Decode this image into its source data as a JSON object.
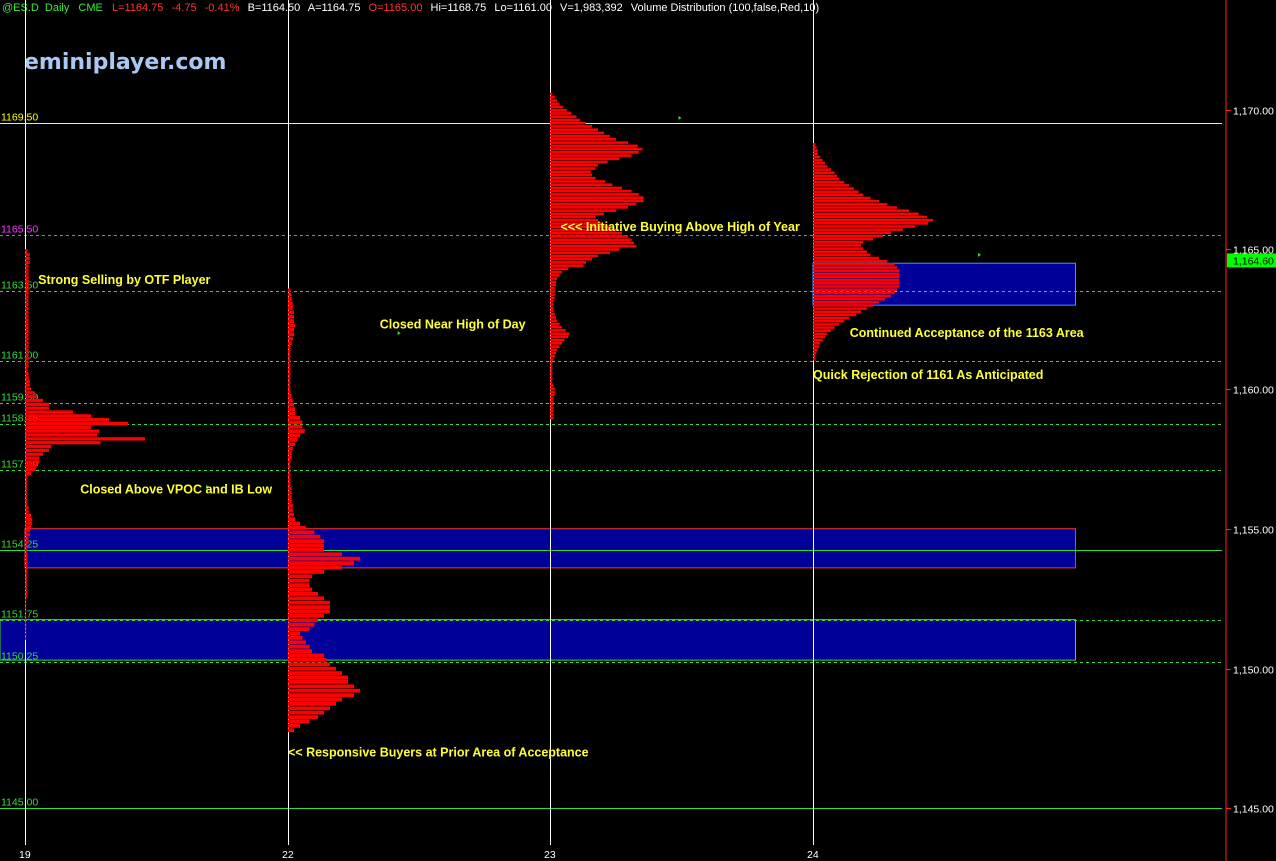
{
  "header": {
    "symbol": "@ES.D",
    "interval": "Daily",
    "exchange": "CME",
    "last": "L=1164.75",
    "change": "-4.75",
    "change_pct": "-0.41%",
    "bid": "B=1164.50",
    "ask": "A=1164.75",
    "open": "O=1165.00",
    "high": "Hi=1168.75",
    "low": "Lo=1161.00",
    "volume": "V=1,983,392",
    "study": "Volume Distribution (100,false,Red,10)"
  },
  "brand": "eminiplayer.com",
  "colors": {
    "background": "#000000",
    "profile": "#ff0000",
    "value_area": "#000099",
    "annotation": "#ffff33",
    "resistance_line": "#ffff00",
    "pink_line": "#ff33ff",
    "green_line": "#33dd33",
    "price_box": "#00ff00"
  },
  "chart_data": {
    "type": "volume-profile",
    "title": "",
    "ylim": [
      1144.4,
      1172.0
    ],
    "y_ticks": [
      "1,170.00",
      "1,165.00",
      "1,160.00",
      "1,155.00",
      "1,150.00",
      "1,145.00"
    ],
    "y_tick_values": [
      1170,
      1165,
      1160,
      1155,
      1150,
      1145
    ],
    "current_price": "1,164.60",
    "current_price_value": 1164.6,
    "dates": [
      "19",
      "22",
      "23",
      "24"
    ],
    "levels": [
      {
        "label": "1169.50",
        "value": 1169.5,
        "style": "solid",
        "color": "#ffff00"
      },
      {
        "label": "1165.50",
        "value": 1165.5,
        "style": "dashed",
        "color": "#ff33ff"
      },
      {
        "label": "1163.50",
        "value": 1163.5,
        "style": "dashed",
        "color": "#33dd33"
      },
      {
        "label": "1161.00",
        "value": 1161.0,
        "style": "dashed",
        "color": "#33dd33"
      },
      {
        "label": "1159.50",
        "value": 1159.5,
        "style": "dashed",
        "color": "#33dd33"
      },
      {
        "label": "1158.75",
        "value": 1158.75,
        "style": "dashed",
        "color": "#33dd33"
      },
      {
        "label": "1157.09",
        "value": 1157.09,
        "style": "dashed",
        "color": "#33dd33"
      },
      {
        "label": "1154.25",
        "value": 1154.25,
        "style": "solid",
        "color": "#33dd33"
      },
      {
        "label": "1151.75",
        "value": 1151.75,
        "style": "dashed",
        "color": "#33dd33"
      },
      {
        "label": "1150.25",
        "value": 1150.25,
        "style": "dashed",
        "color": "#33dd33"
      },
      {
        "label": "1145.00",
        "value": 1145.0,
        "style": "solid",
        "color": "#33dd33"
      }
    ],
    "value_areas": [
      {
        "day": 3,
        "top": 1164.5,
        "bottom": 1163.0,
        "end_day": 4.0,
        "edge": "#3399ff"
      },
      {
        "day": 0,
        "top": 1155.0,
        "bottom": 1153.6,
        "end_day": 4.0,
        "edge": "#ff3333"
      },
      {
        "day": -0.1,
        "top": 1151.75,
        "bottom": 1150.3,
        "end_day": 4.0,
        "edge": "#33dd33"
      }
    ],
    "profiles": [
      {
        "day": "19",
        "low": 1151.0,
        "high": 1165.0,
        "volumes": [
          2,
          4,
          4,
          4,
          3,
          3,
          3,
          3,
          3,
          3,
          3,
          3,
          3,
          3,
          3,
          3,
          3,
          3,
          3,
          3,
          3,
          3,
          3,
          3,
          3,
          3,
          3,
          3,
          3,
          3,
          3,
          2,
          3,
          3,
          4,
          4,
          5,
          8,
          10,
          15,
          20,
          20,
          40,
          55,
          70,
          86,
          55,
          62,
          60,
          100,
          63,
          22,
          20,
          15,
          12,
          12,
          10,
          9,
          5,
          2,
          2,
          2,
          2,
          2,
          2,
          2,
          2,
          3,
          3,
          5,
          6,
          6,
          5,
          4,
          4,
          3,
          3,
          2,
          2,
          2,
          2,
          2,
          2,
          2,
          2,
          2,
          2,
          2,
          2,
          2,
          2,
          1,
          1,
          1,
          1,
          1,
          1,
          1,
          1,
          1,
          1,
          1
        ]
      },
      {
        "day": "22",
        "low": 1147.7,
        "high": 1163.6,
        "volumes": [
          2,
          3,
          3,
          4,
          4,
          5,
          5,
          5,
          6,
          5,
          5,
          4,
          3,
          2,
          2,
          2,
          2,
          2,
          2,
          2,
          2,
          2,
          2,
          2,
          3,
          4,
          5,
          6,
          6,
          10,
          12,
          12,
          14,
          10,
          8,
          6,
          4,
          3,
          3,
          2,
          2,
          2,
          2,
          2,
          2,
          3,
          3,
          3,
          3,
          4,
          4,
          5,
          6,
          10,
          15,
          22,
          27,
          30,
          30,
          30,
          45,
          60,
          55,
          45,
          30,
          20,
          18,
          18,
          20,
          25,
          30,
          35,
          35,
          35,
          30,
          25,
          22,
          18,
          10,
          12,
          15,
          18,
          20,
          30,
          32,
          35,
          40,
          45,
          50,
          50,
          55,
          60,
          55,
          45,
          40,
          35,
          30,
          25,
          18,
          10,
          5
        ]
      },
      {
        "day": "23",
        "low": 1158.9,
        "high": 1170.6,
        "volumes": [
          2,
          4,
          6,
          8,
          11,
          14,
          18,
          22,
          25,
          30,
          35,
          40,
          45,
          50,
          55,
          65,
          73,
          77,
          74,
          68,
          58,
          48,
          40,
          38,
          34,
          35,
          38,
          46,
          52,
          60,
          68,
          74,
          78,
          78,
          72,
          65,
          55,
          45,
          38,
          40,
          44,
          50,
          55,
          60,
          65,
          68,
          70,
          72,
          58,
          50,
          40,
          35,
          30,
          28,
          15,
          10,
          8,
          6,
          5,
          5,
          4,
          4,
          4,
          4,
          3,
          3,
          3,
          3,
          4,
          5,
          6,
          8,
          10,
          13,
          16,
          15,
          12,
          10,
          8,
          6,
          5,
          4,
          3,
          2,
          2,
          2,
          2,
          2,
          2,
          2,
          3,
          4,
          4,
          4,
          3,
          3,
          3,
          3,
          3,
          3,
          3
        ]
      },
      {
        "day": "24",
        "low": 1161.0,
        "high": 1168.8,
        "volumes": [
          2,
          3,
          4,
          4,
          6,
          8,
          10,
          12,
          15,
          18,
          20,
          22,
          26,
          30,
          34,
          38,
          42,
          48,
          55,
          62,
          70,
          80,
          88,
          95,
          100,
          96,
          85,
          75,
          65,
          58,
          50,
          42,
          40,
          42,
          45,
          48,
          55,
          62,
          68,
          70,
          72,
          72,
          72,
          72,
          72,
          72,
          70,
          68,
          65,
          60,
          55,
          50,
          45,
          40,
          36,
          30,
          26,
          22,
          18,
          15,
          12,
          10,
          8,
          6,
          5,
          4,
          3,
          2,
          2
        ]
      }
    ],
    "annotations": [
      {
        "text": "Strong Selling by OTF Player",
        "day": 0.05,
        "price": 1163.9
      },
      {
        "text": "Closed Above VPOC and IB Low",
        "day": 0.21,
        "price": 1156.4
      },
      {
        "text": "Closed Near High of Day",
        "day": 1.35,
        "price": 1162.3
      },
      {
        "text": "<< Responsive Buyers at Prior Area of Acceptance",
        "day": 1.0,
        "price": 1147.0
      },
      {
        "text": "<<< Initiative Buying Above High of Year",
        "day": 2.04,
        "price": 1165.8
      },
      {
        "text": "Continued Acceptance of the 1163 Area",
        "day": 3.14,
        "price": 1162.0
      },
      {
        "text": "Quick Rejection of 1161 As Anticipated",
        "day": 3.0,
        "price": 1160.5
      }
    ],
    "markers": [
      {
        "day": 1.43,
        "price": 1162.0
      },
      {
        "day": 0.7,
        "price": 1156.5
      },
      {
        "day": 2.5,
        "price": 1169.7
      },
      {
        "day": 3.64,
        "price": 1164.8
      }
    ]
  }
}
